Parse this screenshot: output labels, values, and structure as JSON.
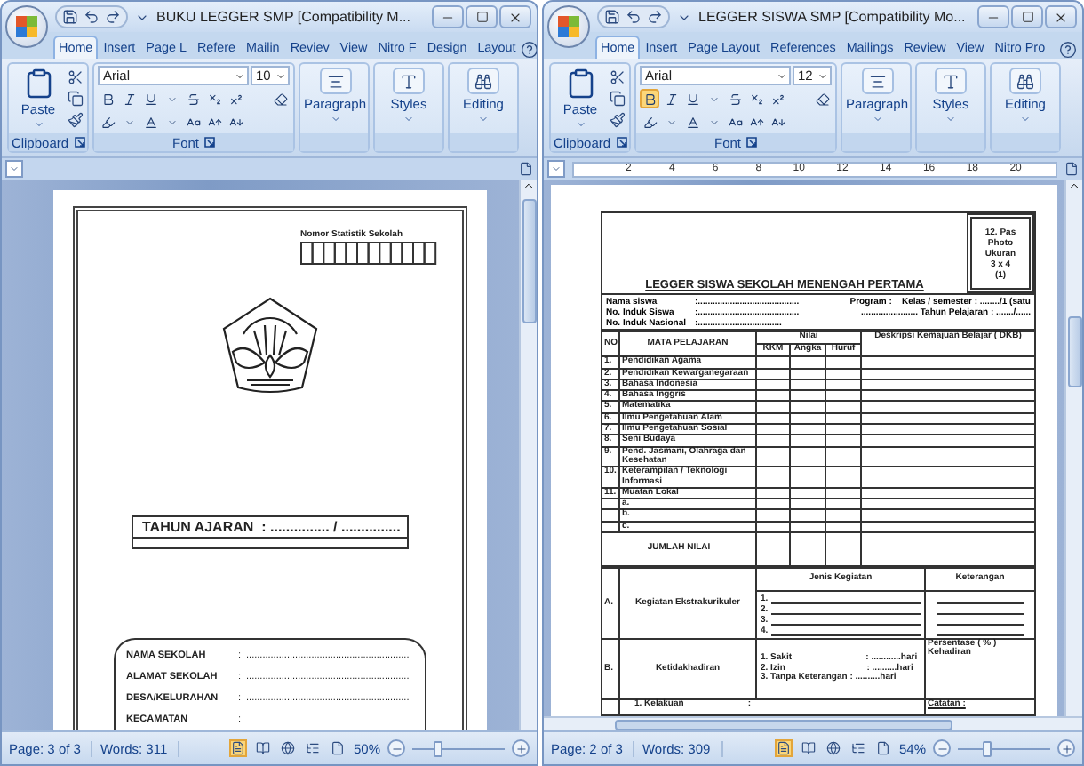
{
  "windows": [
    {
      "title": "BUKU LEGGER SMP [Compatibility M...",
      "tabs": [
        {
          "label": "Home",
          "selected": true
        },
        {
          "label": "Insert",
          "selected": false
        },
        {
          "label": "Page L",
          "selected": false
        },
        {
          "label": "Refere",
          "selected": false
        },
        {
          "label": "Mailin",
          "selected": false
        },
        {
          "label": "Reviev",
          "selected": false
        },
        {
          "label": "View",
          "selected": false
        },
        {
          "label": "Nitro F",
          "selected": false
        },
        {
          "label": "Design",
          "selected": false
        },
        {
          "label": "Layout",
          "selected": false
        }
      ],
      "ribbon": {
        "paste": "Paste",
        "clipboard": "Clipboard",
        "font_name": "Arial",
        "font_size": "10",
        "bold_active": false,
        "font": "Font",
        "paragraph": "Paragraph",
        "styles": "Styles",
        "editing": "Editing"
      },
      "document": {
        "kind": "cover",
        "statistic_label": "Nomor Statistik Sekolah",
        "year_line": "TAHUN AJARAN  : ............... / ...............",
        "fields": [
          {
            "label": "NAMA SEKOLAH",
            "separator": ":",
            "value": "............................................................"
          },
          {
            "label": "ALAMAT SEKOLAH",
            "separator": ":",
            "value": "............................................................"
          },
          {
            "label": "DESA/KELURAHAN",
            "separator": ":",
            "value": "............................................................"
          },
          {
            "label": "KECAMATAN",
            "separator": ":"
          }
        ]
      },
      "status_bar": {
        "page": "Page: 3 of 3",
        "words": "Words: 311",
        "zoom": "50%",
        "zoom_slider": {
          "level": 0.27
        }
      }
    },
    {
      "title": "LEGGER SISWA SMP [Compatibility Mo...",
      "tabs": [
        {
          "label": "Home",
          "selected": true
        },
        {
          "label": "Insert",
          "selected": false
        },
        {
          "label": "Page Layout",
          "selected": false
        },
        {
          "label": "References",
          "selected": false
        },
        {
          "label": "Mailings",
          "selected": false
        },
        {
          "label": "Review",
          "selected": false
        },
        {
          "label": "View",
          "selected": false
        },
        {
          "label": "Nitro Pro",
          "selected": false
        }
      ],
      "ribbon": {
        "paste": "Paste",
        "clipboard": "Clipboard",
        "font_name": "Arial",
        "font_size": "12",
        "bold_active": true,
        "font": "Font",
        "paragraph": "Paragraph",
        "styles": "Styles",
        "editing": "Editing"
      },
      "ruler_numbers": [
        "2",
        "4",
        "6",
        "8",
        "10",
        "12",
        "14",
        "16",
        "18",
        "20"
      ],
      "document": {
        "kind": "legger",
        "photo_box": [
          "12. Pas",
          "Photo",
          "Ukuran",
          "3 x 4",
          "(1)"
        ],
        "title": "LEGGER SISWA SEKOLAH MENENGAH PERTAMA",
        "identity_left": [
          {
            "label": "Nama siswa",
            "value": ":........................................."
          },
          {
            "label": "No. Induk Siswa",
            "value": ":........................................."
          },
          {
            "label": "No. Induk Nasional",
            "value": ":.................................."
          }
        ],
        "identity_right": [
          "Program :    Kelas / semester : ......../1 (satu",
          "....................... Tahun Pelajaran : ......./......"
        ],
        "grade_headers": {
          "no": "NO",
          "subject": "MATA PELAJARAN",
          "score": "Nilai",
          "kkm": "KKM",
          "number": "Angka",
          "letter": "Huruf",
          "description": "Deskripsi Kemajuan Belajar ( DKB)"
        },
        "subjects": [
          {
            "no": "1.",
            "name": "Pendidikan Agama"
          },
          {
            "no": "2.",
            "name": "Pendidikan Kewarganegaraan"
          },
          {
            "no": "3.",
            "name": "Bahasa Indonesia"
          },
          {
            "no": "4.",
            "name": "Bahasa Inggris"
          },
          {
            "no": "5.",
            "name": "Matematika"
          },
          {
            "no": "6.",
            "name": "Ilmu Pengetahuan Alam"
          },
          {
            "no": "7.",
            "name": "Ilmu Pengetahuan Sosial"
          },
          {
            "no": "8.",
            "name": "Seni Budaya"
          },
          {
            "no": "9.",
            "name": "Pend. Jasmani, Olahraga dan Kesehatan"
          },
          {
            "no": "10.",
            "name": "Keterampilan / Teknologi Informasi"
          },
          {
            "no": "11.",
            "name": "Muatan Lokal"
          },
          {
            "name": "a."
          },
          {
            "name": "b."
          },
          {
            "name": "c."
          }
        ],
        "total": "JUMLAH NILAI",
        "extracurricular": {
          "letter": "A.",
          "label": "Kegiatan Ekstrakurikuler",
          "type_header": "Jenis Kegiatan",
          "note_header": "Keterangan",
          "items": [
            "1.",
            "2.",
            "3.",
            "4."
          ]
        },
        "absence": {
          "letter": "B.",
          "label": "Ketidakhadiran",
          "items": [
            "1. Sakit                              : ............hari",
            "2. Izin                                 : ..........hari",
            "3. Tanpa Keterangan : ..........hari"
          ],
          "note": "Persentase ( % ) Kehadiran"
        },
        "personality": {
          "item": "1. Kelakuan                          :",
          "note": "Catatan :"
        }
      },
      "status_bar": {
        "page": "Page: 2 of 3",
        "words": "Words: 309",
        "zoom": "54%",
        "zoom_slider": {
          "level": 0.3
        }
      }
    }
  ]
}
